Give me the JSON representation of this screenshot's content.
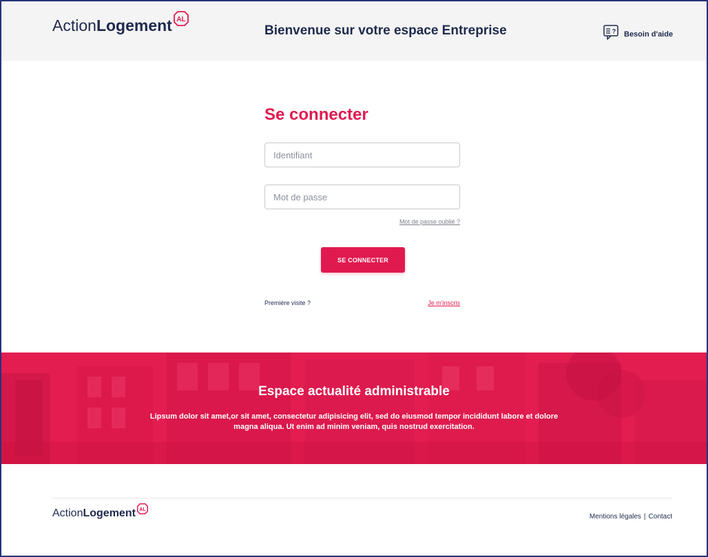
{
  "brand": {
    "word1": "Action",
    "word2": "Logement",
    "mark_text": "AL",
    "color": "#e01a4f"
  },
  "header": {
    "title": "Bienvenue sur votre espace Entreprise",
    "help": {
      "label": "Besoin d'aide",
      "icon": "help-chat-icon",
      "icon_text": "≡?"
    }
  },
  "login": {
    "title": "Se connecter",
    "identifier": {
      "placeholder": "Identifiant",
      "value": ""
    },
    "password": {
      "placeholder": "Mot de passe",
      "value": ""
    },
    "forgot_label": "Mot de passe oublié ?",
    "submit_label": "SE CONNECTER",
    "first_visit_label": "Première visite ?",
    "signup_label": "Je m'inscris"
  },
  "news": {
    "title": "Espace actualité administrable",
    "text": "Lipsum dolor sit amet,or sit amet, consectetur adipisicing elit, sed do eiusmod tempor incididunt labore et dolore magna aliqua. Ut enim ad minim veniam, quis nostrud exercitation.",
    "background_color": "#e31d50"
  },
  "footer": {
    "legal_label": "Mentions légales",
    "separator": "|",
    "contact_label": "Contact"
  }
}
